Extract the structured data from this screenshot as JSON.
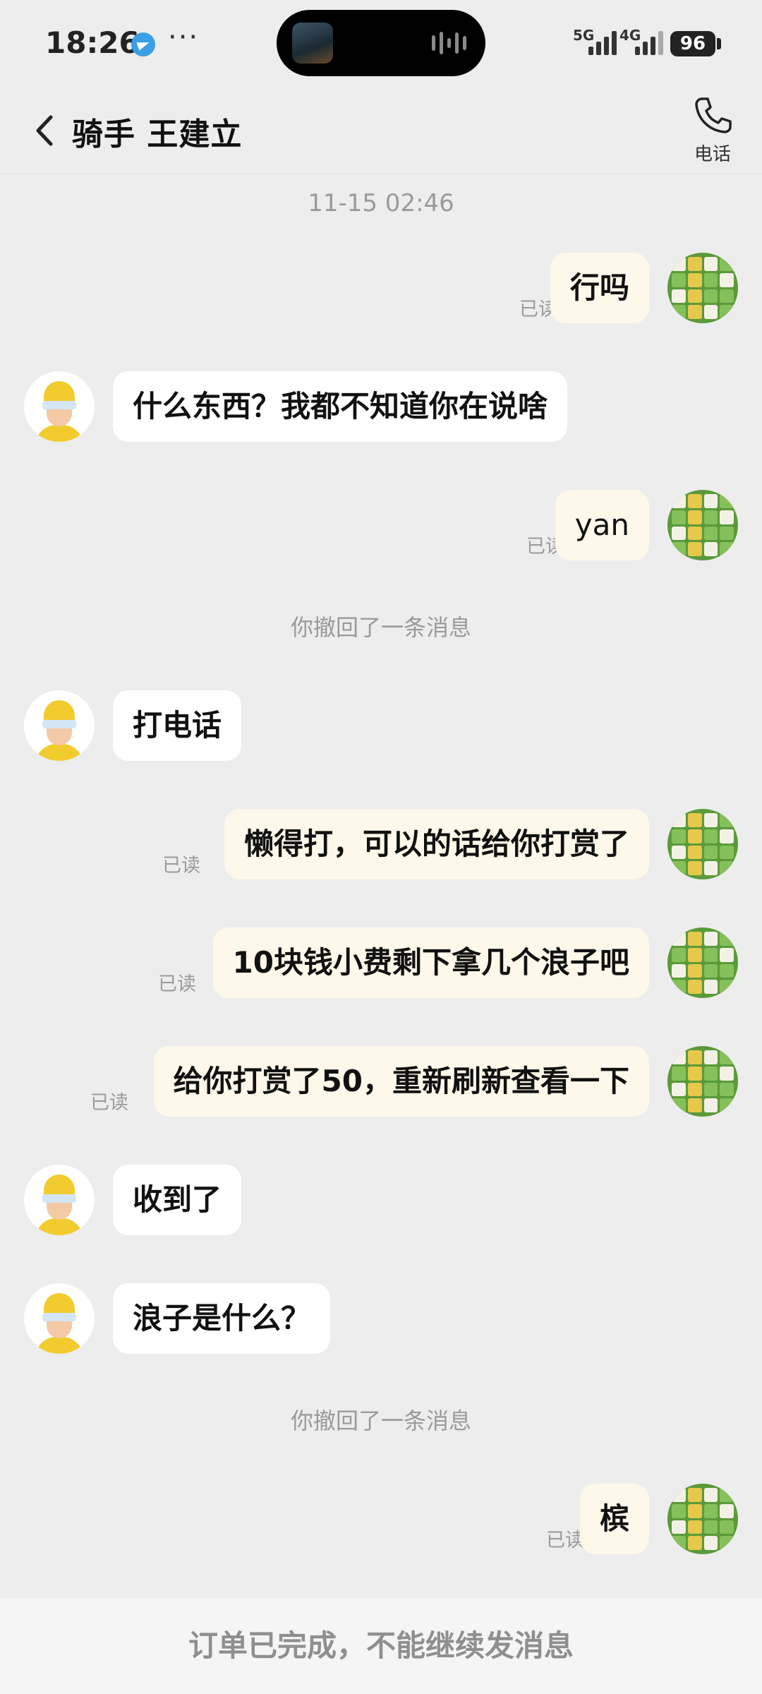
{
  "status_bar": {
    "time": "18:26",
    "net1": "5G",
    "net2": "4G",
    "battery": "96"
  },
  "header": {
    "title": "骑手 王建立",
    "call_label": "电话"
  },
  "messages": {
    "timestamp": "11-15 02:46",
    "m1": {
      "text": "行吗",
      "read": "已读"
    },
    "m2": {
      "text": "什么东西？我都不知道你在说啥"
    },
    "m3": {
      "text": "yan",
      "read": "已读"
    },
    "recall1": "你撤回了一条消息",
    "m4": {
      "text": "打电话"
    },
    "m5": {
      "text": "懒得打，可以的话给你打赏了",
      "read": "已读"
    },
    "m6": {
      "text": "10块钱小费剩下拿几个浪子吧",
      "read": "已读"
    },
    "m7": {
      "text": "给你打赏了50，重新刷新查看一下",
      "read": "已读"
    },
    "m8": {
      "text": "收到了"
    },
    "m9": {
      "text": "浪子是什么？"
    },
    "recall2": "你撤回了一条消息",
    "m10": {
      "text": "槟",
      "read": "已读"
    }
  },
  "footer": {
    "notice": "订单已完成，不能继续发消息"
  },
  "colors": {
    "background": "#ededed",
    "self_bubble": "#fdf8e9",
    "other_bubble": "#ffffff",
    "muted_text": "#9a9a9a"
  }
}
